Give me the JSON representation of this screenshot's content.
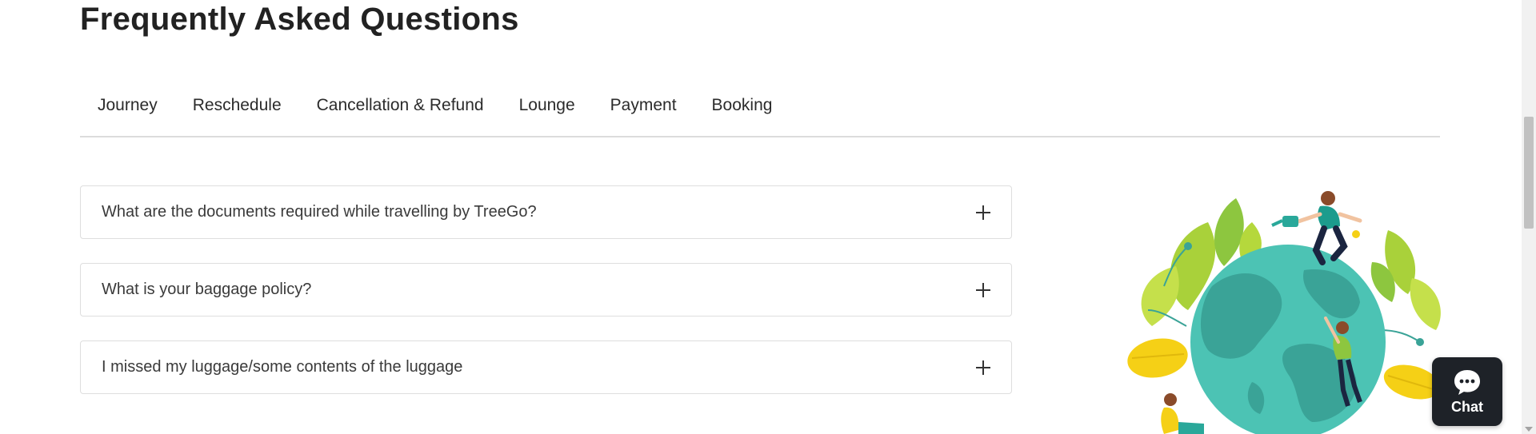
{
  "section": {
    "title": "Frequently Asked Questions"
  },
  "tabs": [
    {
      "label": "Journey"
    },
    {
      "label": "Reschedule"
    },
    {
      "label": "Cancellation & Refund"
    },
    {
      "label": "Lounge"
    },
    {
      "label": "Payment"
    },
    {
      "label": "Booking"
    }
  ],
  "faqs": [
    {
      "question": "What are the documents required while travelling by TreeGo?",
      "icon": "plus-icon"
    },
    {
      "question": "What is your baggage policy?",
      "icon": "plus-icon"
    },
    {
      "question": "I missed my luggage/some contents of the luggage",
      "icon": "plus-icon"
    }
  ],
  "chat": {
    "label": "Chat",
    "icon": "chat-bubble-icon",
    "background": "#1e2228"
  },
  "illustration": {
    "name": "earth-people-plants-illustration"
  },
  "colors": {
    "globe": "#4cc3b4",
    "globe_land": "#3aa397",
    "leaf_green": "#a9d13a",
    "leaf_yellow": "#f5d016",
    "border": "#dedede"
  }
}
